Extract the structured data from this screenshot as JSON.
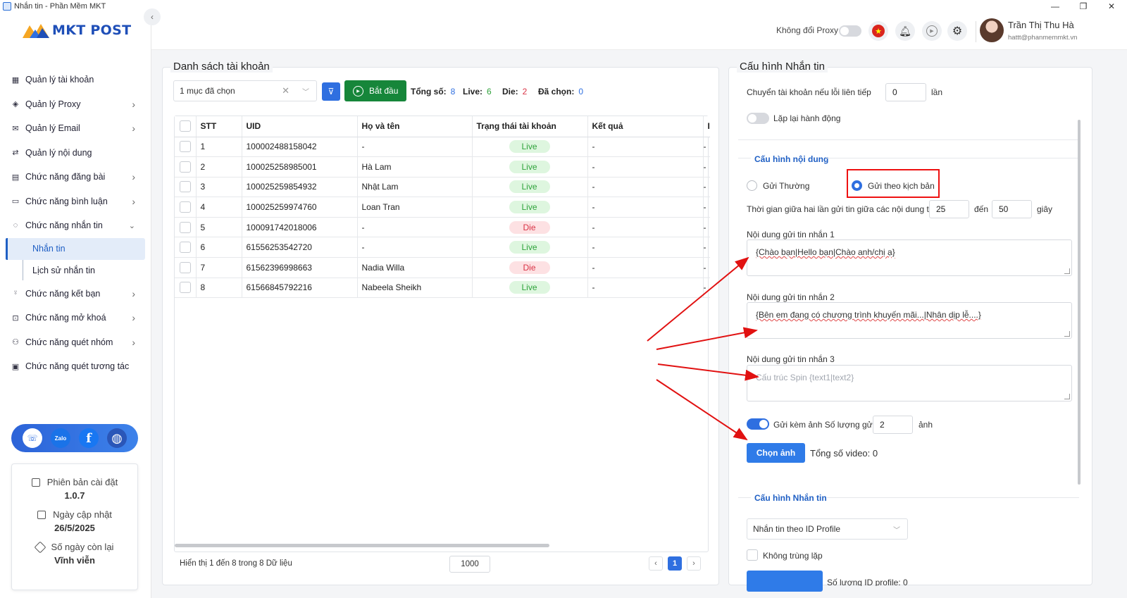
{
  "window": {
    "title": "Nhắn tin - Phần Mềm MKT",
    "controls": [
      "—",
      "❐",
      "✕"
    ]
  },
  "logo": {
    "text": "MKT POST"
  },
  "sidebar": {
    "items": [
      {
        "label": "Quản lý tài khoản",
        "icon": "dashboard-icon",
        "chevron": false
      },
      {
        "label": "Quản lý Proxy",
        "icon": "layers-icon",
        "chevron": true
      },
      {
        "label": "Quản lý Email",
        "icon": "mail-icon",
        "chevron": true
      },
      {
        "label": "Quản lý nội dung",
        "icon": "swap-icon",
        "chevron": false
      },
      {
        "label": "Chức năng đăng bài",
        "icon": "post-icon",
        "chevron": true
      },
      {
        "label": "Chức năng bình luận",
        "icon": "comment-icon",
        "chevron": true
      },
      {
        "label": "Chức năng nhắn tin",
        "icon": "chat-icon",
        "chevron": true,
        "expanded": true
      }
    ],
    "subitems": [
      {
        "label": "Nhắn tin",
        "active": true
      },
      {
        "label": "Lịch sử nhắn tin",
        "active": false
      }
    ],
    "items_after": [
      {
        "label": "Chức năng kết bạn",
        "icon": "user-add-icon",
        "chevron": true
      },
      {
        "label": "Chức năng mở khoá",
        "icon": "lock-icon",
        "chevron": true
      },
      {
        "label": "Chức năng quét nhóm",
        "icon": "group-icon",
        "chevron": true
      },
      {
        "label": "Chức năng quét tương tác",
        "icon": "scan-icon",
        "chevron": false
      }
    ],
    "social": [
      "support-icon",
      "zalo-icon",
      "facebook-icon",
      "globe-icon"
    ],
    "info": {
      "version_label": "Phiên bản cài đặt",
      "version": "1.0.7",
      "updated_label": "Ngày cập nhật",
      "updated": "26/5/2025",
      "days_label": "Số ngày còn lại",
      "days": "Vĩnh viễn"
    }
  },
  "header": {
    "proxy_label": "Không đổi Proxy",
    "proxy_on": false,
    "user_name": "Trần Thị Thu Hà",
    "user_email": "hattt@phanmemmkt.vn"
  },
  "accounts": {
    "title": "Danh sách tài khoản",
    "select_value": "1 mục đã chọn",
    "start_label": "Bắt đầu",
    "stats": {
      "total_label": "Tổng số:",
      "total": "8",
      "live_label": "Live:",
      "live": "6",
      "die_label": "Die:",
      "die": "2",
      "selected_label": "Đã chọn:",
      "selected": "0"
    },
    "columns": [
      "STT",
      "UID",
      "Họ và tên",
      "Trạng thái tài khoản",
      "Kết quả",
      "I"
    ],
    "rows": [
      {
        "stt": "1",
        "uid": "100002488158042",
        "name": "-",
        "status": "Live",
        "result": "-"
      },
      {
        "stt": "2",
        "uid": "100025258985001",
        "name": "Hà Lam",
        "status": "Live",
        "result": "-"
      },
      {
        "stt": "3",
        "uid": "100025259854932",
        "name": "Nhật Lam",
        "status": "Live",
        "result": "-"
      },
      {
        "stt": "4",
        "uid": "100025259974760",
        "name": "Loan Tran",
        "status": "Live",
        "result": "-"
      },
      {
        "stt": "5",
        "uid": "100091742018006",
        "name": "-",
        "status": "Die",
        "result": "-"
      },
      {
        "stt": "6",
        "uid": "61556253542720",
        "name": "-",
        "status": "Live",
        "result": "-"
      },
      {
        "stt": "7",
        "uid": "61562396998663",
        "name": "Nadia Willa",
        "status": "Die",
        "result": "-"
      },
      {
        "stt": "8",
        "uid": "61566845792216",
        "name": "Nabeela Sheikh",
        "status": "Live",
        "result": "-"
      }
    ],
    "footer_text": "Hiển thị 1 đến 8 trong 8 Dữ liệu",
    "page_size": "1000",
    "page": "1"
  },
  "config": {
    "title": "Cấu hình Nhắn tin",
    "switch_label": "Chuyển tài khoản nếu lỗi liên tiếp",
    "switch_value": "0",
    "switch_unit": "lần",
    "repeat_label": "Lặp lại hành động",
    "content_section": "Cấu hình nội dung",
    "radio_normal": "Gửi Thường",
    "radio_script": "Gửi theo kịch bản",
    "interval_label": "Thời gian giữa hai lần gửi tin giữa các nội dung từ",
    "interval_from": "25",
    "interval_to_label": "đến",
    "interval_to": "50",
    "interval_unit": "giây",
    "msg1_label": "Nội dung gửi tin nhắn 1",
    "msg1_value": "{Chào bạn|Hello bạn|Chào anh/chị ạ}",
    "msg2_label": "Nội dung gửi tin nhắn 2",
    "msg2_value": "{Bên em đang có chương trình khuyến mãi...|Nhân dịp lễ....}",
    "msg3_label": "Nội dung gửi tin nhắn 3",
    "msg3_placeholder": "Cấu trúc Spin {text1|text2}",
    "attach_label": "Gửi kèm ảnh Số lượng gửi",
    "attach_count": "2",
    "attach_unit": "ảnh",
    "choose_image": "Chọn ảnh",
    "video_count": "Tổng số video: 0",
    "message_section": "Cấu hình Nhắn tin",
    "mode_value": "Nhắn tin theo ID Profile",
    "no_dup_label": "Không trùng lặp",
    "bottom_text": "Số lượng ID profile: 0"
  },
  "colors": {
    "accent": "#2f6fe0",
    "green": "#16863a",
    "live": "#2fa23b",
    "die": "#d93345",
    "annotation": "#e11111"
  }
}
